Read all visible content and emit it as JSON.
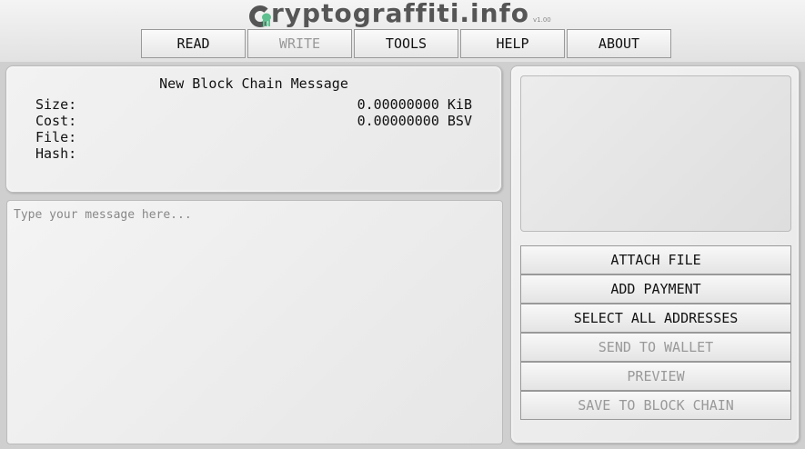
{
  "header": {
    "logo_text": "ryptograffiti.info",
    "version": "v1.00",
    "logo_icon": "squid-icon"
  },
  "nav": [
    {
      "label": "READ",
      "enabled": true
    },
    {
      "label": "WRITE",
      "enabled": false
    },
    {
      "label": "TOOLS",
      "enabled": true
    },
    {
      "label": "HELP",
      "enabled": true
    },
    {
      "label": "ABOUT",
      "enabled": true
    }
  ],
  "info": {
    "title": "New Block Chain Message",
    "size_label": "Size:",
    "size_value": "0.00000000 KiB",
    "cost_label": "Cost:",
    "cost_value": "0.00000000 BSV",
    "file_label": "File:",
    "file_value": "",
    "hash_label": "Hash:",
    "hash_value": ""
  },
  "message": {
    "placeholder": "Type your message here...",
    "value": ""
  },
  "actions": [
    {
      "label": "ATTACH FILE",
      "enabled": true
    },
    {
      "label": "ADD PAYMENT",
      "enabled": true
    },
    {
      "label": "SELECT ALL ADDRESSES",
      "enabled": true
    },
    {
      "label": "SEND TO WALLET",
      "enabled": false
    },
    {
      "label": "PREVIEW",
      "enabled": false
    },
    {
      "label": "SAVE TO BLOCK CHAIN",
      "enabled": false
    }
  ],
  "colors": {
    "logo_accent": "#5fbf8f",
    "disabled_text": "#999999"
  }
}
